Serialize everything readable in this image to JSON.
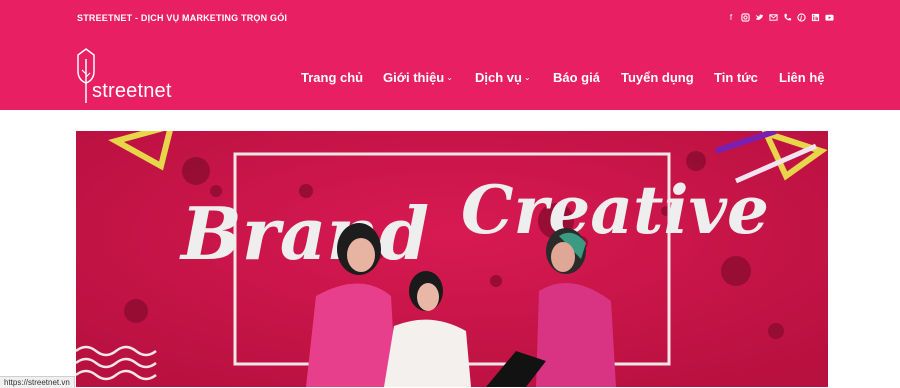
{
  "topbar": {
    "text": "STREETNET - DỊCH VỤ MARKETING TRỌN GÓI",
    "socials": [
      "facebook-icon",
      "instagram-icon",
      "twitter-icon",
      "email-icon",
      "phone-icon",
      "pinterest-icon",
      "linkedin-icon",
      "youtube-icon"
    ]
  },
  "logo": {
    "text": "streetnet"
  },
  "nav": {
    "items": [
      {
        "label": "Trang chủ",
        "dropdown": false
      },
      {
        "label": "Giới thiệu",
        "dropdown": true
      },
      {
        "label": "Dịch vụ",
        "dropdown": true
      },
      {
        "label": "Báo giá",
        "dropdown": false
      },
      {
        "label": "Tuyển dụng",
        "dropdown": false
      },
      {
        "label": "Tin tức",
        "dropdown": false
      },
      {
        "label": "Liên hệ",
        "dropdown": false
      }
    ]
  },
  "banner": {
    "word1": "Brand",
    "word2": "Creative"
  },
  "status": {
    "url": "https://streetnet.vn"
  },
  "colors": {
    "brand": "#e81f62",
    "banner_bg": "#c81448"
  }
}
